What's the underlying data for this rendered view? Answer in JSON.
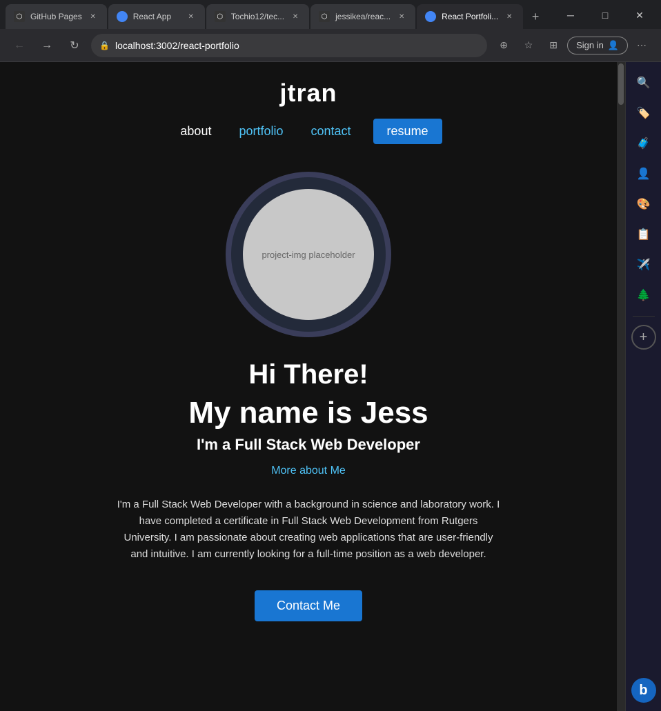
{
  "browser": {
    "tabs": [
      {
        "id": "tab1",
        "label": "GitHub Pages",
        "favicon_type": "gh",
        "active": false
      },
      {
        "id": "tab2",
        "label": "React App",
        "favicon_type": "blue",
        "active": false
      },
      {
        "id": "tab3",
        "label": "Tochio12/tec...",
        "favicon_type": "gh",
        "active": false
      },
      {
        "id": "tab4",
        "label": "jessikea/reac...",
        "favicon_type": "gh",
        "active": false
      },
      {
        "id": "tab5",
        "label": "React Portfoli...",
        "favicon_type": "blue",
        "active": true
      }
    ],
    "address": "localhost:3002/react-portfolio",
    "sign_in_label": "Sign in"
  },
  "site": {
    "title": "jtran",
    "nav": {
      "about": "about",
      "portfolio": "portfolio",
      "contact": "contact",
      "resume": "resume"
    },
    "hero": {
      "placeholder": "project-img placeholder",
      "greeting": "Hi There!",
      "name": "My name is Jess",
      "subtitle": "I'm a Full Stack Web Developer",
      "more_link": "More about Me"
    },
    "bio": "I'm a Full Stack Web Developer with a background in science and laboratory work. I have completed a certificate in Full Stack Web Development from Rutgers University. I am passionate about creating web applications that are user-friendly and intuitive. I am currently looking for a full-time position as a web developer.",
    "contact_btn": "Contact Me"
  },
  "colors": {
    "bg": "#121212",
    "accent_blue": "#1976d2",
    "nav_blue": "#4fc3f7",
    "text_white": "#ffffff",
    "text_dim": "#dddddd"
  }
}
